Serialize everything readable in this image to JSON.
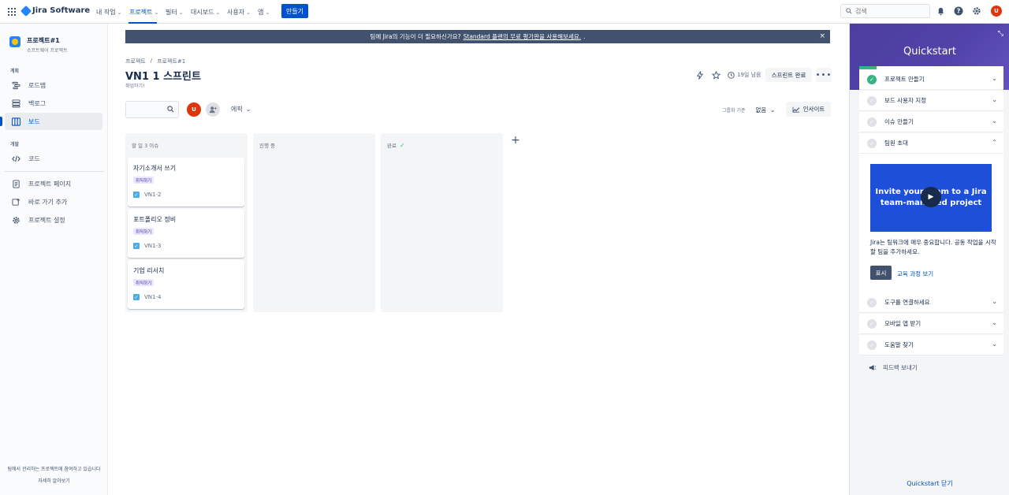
{
  "topnav": {
    "app_name": "Jira Software",
    "items": [
      {
        "label": "내 작업"
      },
      {
        "label": "프로젝트"
      },
      {
        "label": "필터"
      },
      {
        "label": "대시보드"
      },
      {
        "label": "사용자"
      },
      {
        "label": "앱"
      }
    ],
    "create_label": "만들기",
    "search_placeholder": "검색",
    "avatar_initial": "U"
  },
  "sidebar": {
    "project_name": "프로젝트#1",
    "project_type": "소프트웨어 프로젝트",
    "section_plan": "계획",
    "section_dev": "개발",
    "items": [
      {
        "label": "로드맵"
      },
      {
        "label": "백로그"
      },
      {
        "label": "보드"
      },
      {
        "label": "코드"
      },
      {
        "label": "프로젝트 페이지"
      },
      {
        "label": "바로 가기 추가"
      },
      {
        "label": "프로젝트 설정"
      }
    ],
    "footer_text": "팀에서 관리하는 프로젝트에 참여하고 있습니다",
    "footer_link": "자세히 알아보기"
  },
  "banner": {
    "text": "팀에 Jira의 기능이 더 필요하신가요?",
    "link": "Standard 플랜의 무료 평가판을 사용해보세요.",
    "suffix": ".",
    "close": "×"
  },
  "board": {
    "breadcrumb": [
      "프로젝트",
      "/",
      "프로젝트#1"
    ],
    "title": "VN1 1 스프린트",
    "subtitle": "취업하기!",
    "days_left": "19일 남음",
    "complete_label": "스프린트 완료",
    "more_label": "•••",
    "epic_label": "에픽",
    "group_by_label": "그룹화 기준",
    "group_by_value": "없음",
    "insight_label": "인사이트",
    "avatar_initial": "U"
  },
  "columns": [
    {
      "title": "할 일 3 이슈",
      "cards": [
        {
          "title": "자기소개서 쓰기",
          "label": "취직하기",
          "key": "VN1-2"
        },
        {
          "title": "포트폴리오 정비",
          "label": "취직하기",
          "key": "VN1-3"
        },
        {
          "title": "기업 리서치",
          "label": "취직하기",
          "key": "VN1-4"
        }
      ]
    },
    {
      "title": "진행 중",
      "cards": []
    },
    {
      "title": "완료",
      "cards": []
    }
  ],
  "quickstart": {
    "title": "Quickstart",
    "progress": 0.12,
    "items": [
      {
        "label": "프로젝트 만들기",
        "done": true
      },
      {
        "label": "보드 사용자 지정",
        "done": false
      },
      {
        "label": "이슈 만들기",
        "done": false
      },
      {
        "label": "팀원 초대",
        "done": false
      },
      {
        "label": "도구를 연결하세요",
        "done": false
      },
      {
        "label": "모바일 앱 받기",
        "done": false
      },
      {
        "label": "도움말 찾기",
        "done": false
      }
    ],
    "video_text": "Invite your team to a Jira team-managed project",
    "description": "Jira는 팀워크에 매우 중요합니다. 공동 작업을 시작할 팀을 추가하세요.",
    "show_label": "표시",
    "course_label": "교육 과정 보기",
    "feedback_label": "피드백 보내기",
    "close_label": "Quickstart 닫기"
  },
  "colors": {
    "primary": "#0052cc",
    "banner": "#42526e",
    "quickstart_header": "#5243aa",
    "success": "#36b37e",
    "avatar": "#de350b"
  }
}
